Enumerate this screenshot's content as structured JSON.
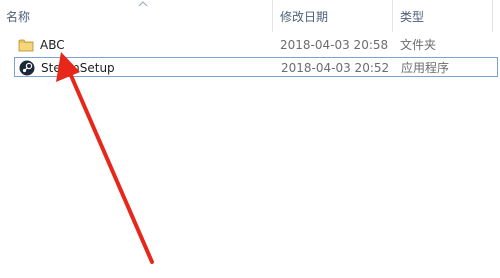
{
  "columns": {
    "name": "名称",
    "modified": "修改日期",
    "type": "类型"
  },
  "files": [
    {
      "name": "ABC",
      "modified": "2018-04-03 20:58",
      "type": "文件夹",
      "icon": "folder-icon"
    },
    {
      "name": "SteamSetup",
      "modified": "2018-04-03 20:52",
      "type": "应用程序",
      "icon": "steam-icon"
    }
  ],
  "colors": {
    "annotation_arrow": "#e8271b",
    "selection_border": "#7da2ce",
    "folder": "#e9c25a"
  }
}
